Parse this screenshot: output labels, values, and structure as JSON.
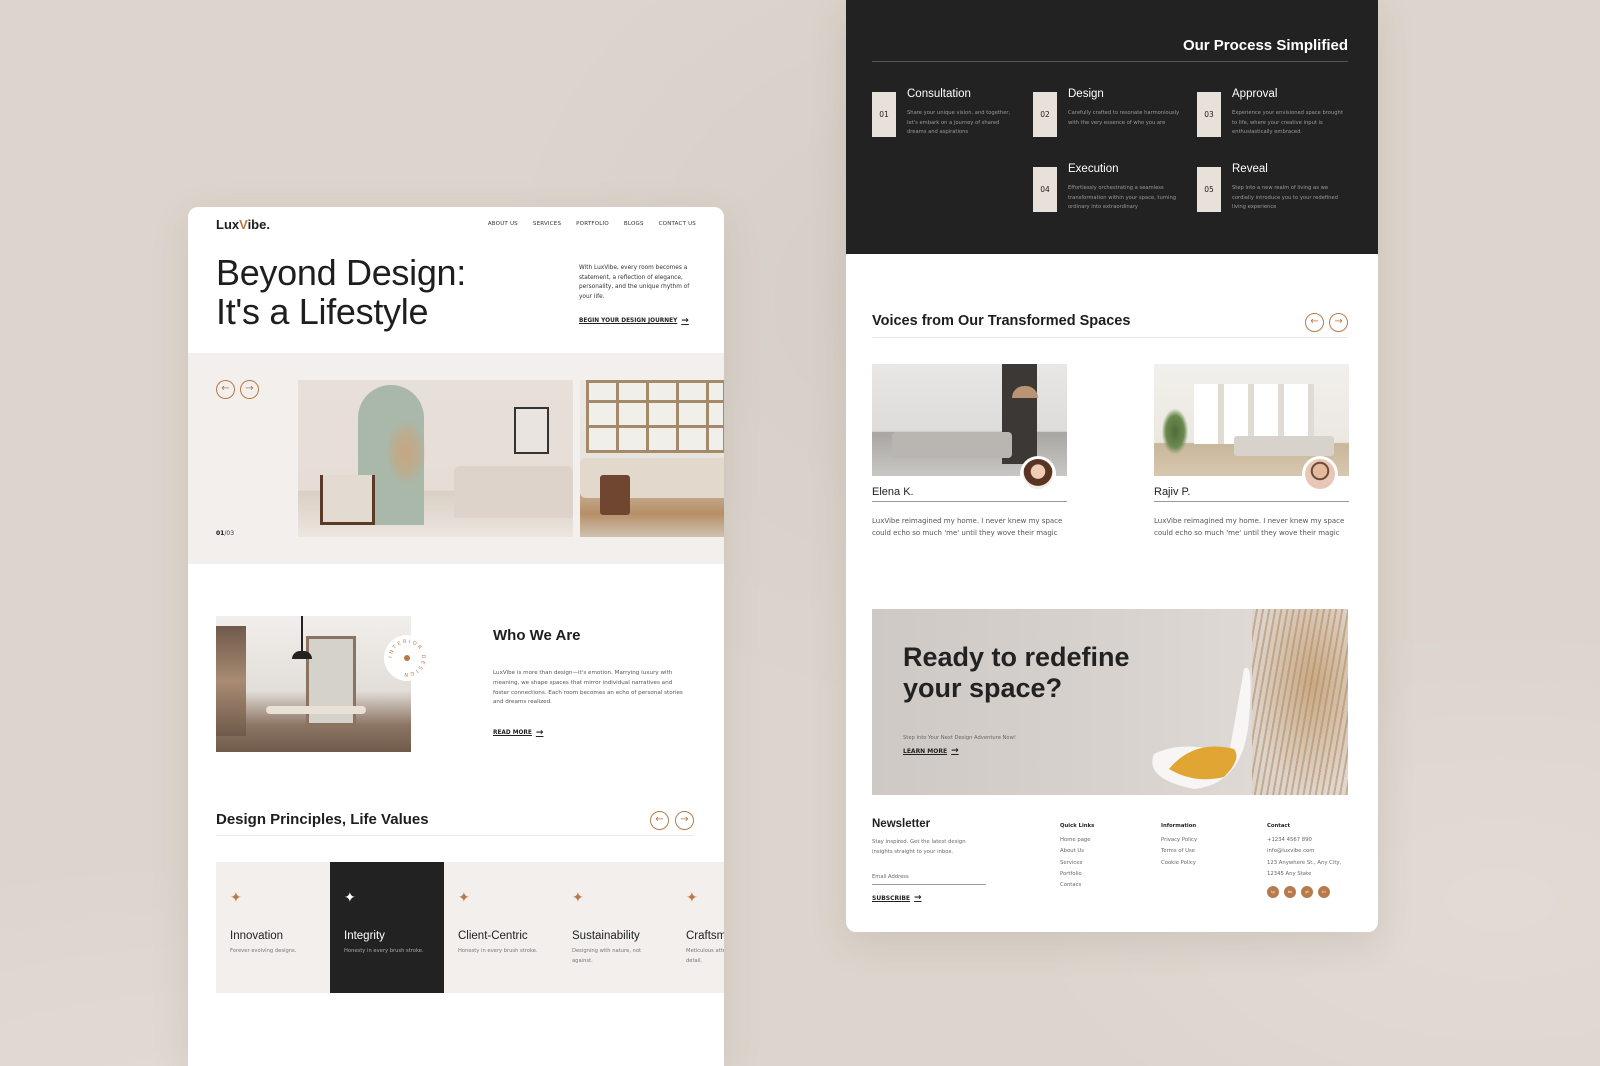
{
  "left_page": {
    "logo": {
      "prefix": "Lux",
      "accent": "V",
      "suffix": "ibe."
    },
    "nav": [
      "ABOUT US",
      "SERVICES",
      "PORTFOLIO",
      "BLOGS",
      "CONTACT US"
    ],
    "hero": {
      "title_line1": "Beyond Design:",
      "title_line2": "It's a Lifestyle",
      "text": "With LuxVibe, every room becomes a statement, a reflection of elegance, personality, and the unique rhythm of your life.",
      "cta": "BEGIN YOUR DESIGN JOURNEY"
    },
    "gallery": {
      "counter_current": "01",
      "counter_total": "/03"
    },
    "about": {
      "badge_text": "INTERIOR DESIGN",
      "title": "Who We Are",
      "text": "LuxVibe is more than design—it's emotion. Marrying luxury with meaning, we shape spaces that mirror individual narratives and foster connections. Each room becomes an echo of personal stories and dreams realized.",
      "cta": "READ MORE"
    },
    "principles": {
      "title": "Design Principles, Life Values",
      "cards": [
        {
          "title": "Innovation",
          "desc": "Forever evolving designs.",
          "active": false
        },
        {
          "title": "Integrity",
          "desc": "Honesty in every brush stroke.",
          "active": true
        },
        {
          "title": "Client-Centric",
          "desc": "Honesty in every brush stroke.",
          "active": false
        },
        {
          "title": "Sustainability",
          "desc": "Designing with nature, not against.",
          "active": false
        },
        {
          "title": "Craftsmanship",
          "desc": "Meticulous attention to every detail.",
          "active": false
        }
      ]
    }
  },
  "right_page": {
    "process": {
      "title": "Our Process Simplified",
      "steps": [
        {
          "num": "01",
          "title": "Consultation",
          "desc": "Share your unique vision, and together, let's embark on a journey of shared dreams and aspirations"
        },
        {
          "num": "02",
          "title": "Design",
          "desc": "Carefully crafted to resonate harmoniously with the very essence of who you are"
        },
        {
          "num": "03",
          "title": "Approval",
          "desc": "Experience your envisioned space brought to life, where your creative input is enthusiastically embraced."
        },
        {
          "num": "04",
          "title": "Execution",
          "desc": "Effortlessly orchestrating a seamless transformation within your space, turning ordinary into extraordinary"
        },
        {
          "num": "05",
          "title": "Reveal",
          "desc": "Step into a new realm of living as we cordially introduce you to your redefined living experience"
        }
      ]
    },
    "testimonials": {
      "title": "Voices from Our Transformed Spaces",
      "items": [
        {
          "name": "Elena K.",
          "quote": "LuxVibe reimagined my home. I never knew my space could echo so much 'me' until they wove their magic"
        },
        {
          "name": "Rajiv P.",
          "quote": "LuxVibe reimagined my home. I never knew my space could echo so much 'me' until they wove their magic"
        }
      ]
    },
    "cta": {
      "title_line1": "Ready to redefine",
      "title_line2": "your space?",
      "sub": "Step into Your Next Design Adventure Now!",
      "link": "LEARN MORE"
    },
    "footer": {
      "newsletter_title": "Newsletter",
      "newsletter_text": "Stay inspired. Get the latest design insights straight to your inbox.",
      "email_placeholder": "Email Address",
      "subscribe": "SUBSCRIBE",
      "quick_links": {
        "heading": "Quick Links",
        "items": [
          "Home page",
          "About Us",
          "Services",
          "Portfolio",
          "Contacs"
        ]
      },
      "information": {
        "heading": "Information",
        "items": [
          "Privacy Policy",
          "Terms of Use",
          "Cookie Policy"
        ]
      },
      "contact": {
        "heading": "Contact",
        "items": [
          "+1234 4567 890",
          "info@luxvibe.com",
          "123 Anywhere St., Any City,",
          "12345 Any State"
        ]
      },
      "socials": [
        "ig",
        "tw",
        "yt",
        "in"
      ]
    }
  },
  "colors": {
    "accent": "#b87a4b",
    "dark": "#222222",
    "background": "#ddd5cd",
    "panel": "#f2efec"
  },
  "icons": {
    "prev": "←",
    "next": "→",
    "star": "✦",
    "arrow": "→"
  }
}
